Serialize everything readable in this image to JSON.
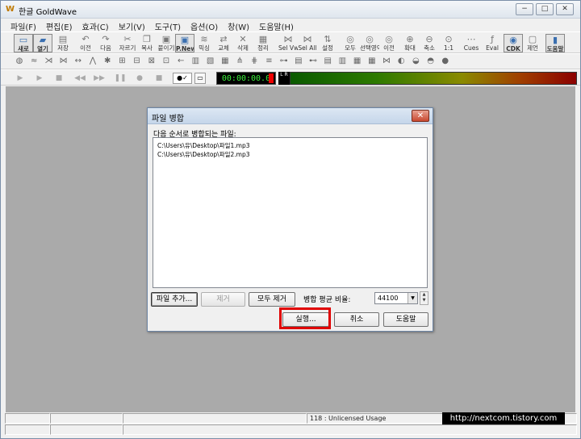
{
  "app": {
    "icon_glyph": "W",
    "title": "한글 GoldWave",
    "window_controls": [
      "−",
      "□",
      "✕"
    ]
  },
  "menu": [
    "파일(F)",
    "편집(E)",
    "효과(C)",
    "보기(V)",
    "도구(T)",
    "옵션(O)",
    "창(W)",
    "도움말(H)"
  ],
  "toolbar_main": [
    {
      "label": "새로",
      "icon": "new-file-icon",
      "glyph": "▭",
      "pressed": true
    },
    {
      "label": "열기",
      "icon": "open-folder-icon",
      "glyph": "▰",
      "pressed": true
    },
    {
      "label": "저장",
      "icon": "save-icon",
      "glyph": "▤"
    },
    {
      "label": "이전",
      "icon": "undo-icon",
      "glyph": "↶"
    },
    {
      "label": "다음",
      "icon": "redo-icon",
      "glyph": "↷"
    },
    {
      "label": "자르기",
      "icon": "cut-icon",
      "glyph": "✂"
    },
    {
      "label": "복사",
      "icon": "copy-icon",
      "glyph": "❐"
    },
    {
      "label": "붙이기",
      "icon": "paste-icon",
      "glyph": "▣"
    },
    {
      "label": "P.New",
      "icon": "paste-new-icon",
      "glyph": "▣",
      "pressed": true
    },
    {
      "label": "믹싱",
      "icon": "mix-icon",
      "glyph": "≋"
    },
    {
      "label": "교체",
      "icon": "replace-icon",
      "glyph": "⇄"
    },
    {
      "label": "삭제",
      "icon": "delete-icon",
      "glyph": "✕"
    },
    {
      "label": "정리",
      "icon": "trim-icon",
      "glyph": "▦"
    },
    {
      "label": "Sel Vw",
      "icon": "select-view-icon",
      "glyph": "⋈"
    },
    {
      "label": "Sel All",
      "icon": "select-all-icon",
      "glyph": "⋈"
    },
    {
      "label": "설정",
      "icon": "set-icon",
      "glyph": "⇅"
    },
    {
      "label": "모두",
      "icon": "all-icon",
      "glyph": "◎"
    },
    {
      "label": "선택영역",
      "icon": "selection-icon",
      "glyph": "◎"
    },
    {
      "label": "이전",
      "icon": "previous-icon",
      "glyph": "◎"
    },
    {
      "label": "확대",
      "icon": "zoom-in-icon",
      "glyph": "⊕"
    },
    {
      "label": "축소",
      "icon": "zoom-out-icon",
      "glyph": "⊖"
    },
    {
      "label": "1:1",
      "icon": "zoom-actual-icon",
      "glyph": "⊙"
    },
    {
      "label": "Cues",
      "icon": "cues-icon",
      "glyph": "⋯"
    },
    {
      "label": "Eval",
      "icon": "eval-icon",
      "glyph": "ƒ"
    },
    {
      "label": "CDK",
      "icon": "cd-icon",
      "glyph": "◉",
      "pressed": true
    },
    {
      "label": "제언",
      "icon": "suggest-icon",
      "glyph": "▢"
    },
    {
      "label": "도움말",
      "icon": "help-book-icon",
      "glyph": "▮",
      "pressed": true
    }
  ],
  "toolbar_effects": [
    "◍",
    "≈",
    "⋊",
    "⋈",
    "↔",
    "⋀",
    "✱",
    "⊞",
    "⊟",
    "⊠",
    "⊡",
    "←",
    "▥",
    "▧",
    "▦",
    "⋔",
    "⋕",
    "≡",
    "⊶",
    "▤",
    "⊷",
    "▤",
    "▥",
    "▦",
    "▦",
    "⋈",
    "◐",
    "◒",
    "◓",
    "●"
  ],
  "playback": {
    "buttons": [
      "▶",
      "▶",
      "■",
      "◀◀",
      "▶▶",
      "❚❚",
      "●",
      "■"
    ],
    "check": "●✓",
    "window_btn": "▭",
    "time": "00:00:00.0",
    "lr_label": "L R"
  },
  "dialog": {
    "title": "파일 병합",
    "close": "✕",
    "list_label": "다음 순서로 병합되는 파일:",
    "files": [
      "C:\\Users\\유\\Desktop\\파일1.mp3",
      "C:\\Users\\유\\Desktop\\파일2.mp3"
    ],
    "add_file": "파일 추가...",
    "remove": "제거",
    "remove_all": "모두 제거",
    "rate_label": "병합 평균 비율:",
    "rate_value": "44100",
    "run": "실행...",
    "cancel": "취소",
    "help": "도움말"
  },
  "status": {
    "usage": "118 : Unlicensed Usage",
    "watermark": "http://nextcom.tistory.com"
  },
  "colors": {
    "workspace": "#aaaaaa",
    "highlight": "#e00000",
    "time_text": "#3cf03c"
  }
}
